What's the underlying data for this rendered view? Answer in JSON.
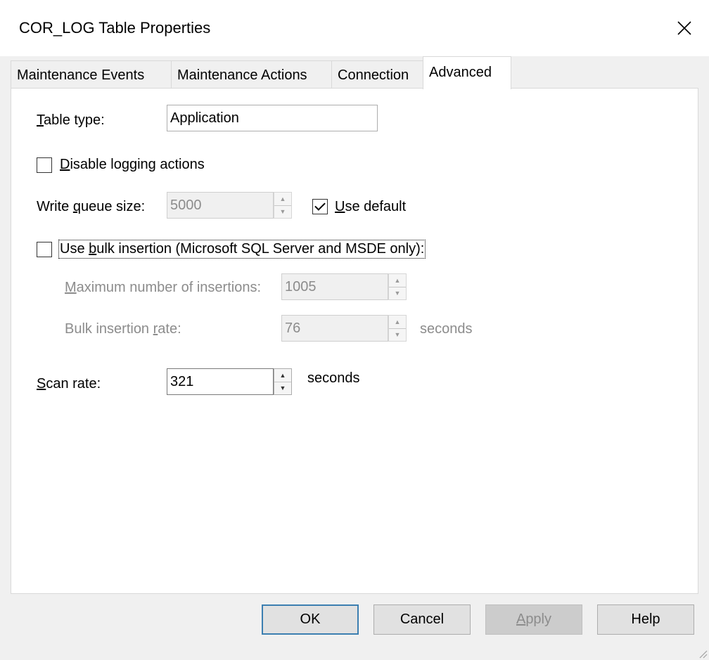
{
  "window": {
    "title": "COR_LOG Table Properties"
  },
  "tabs": [
    {
      "label": "Maintenance Events"
    },
    {
      "label": "Maintenance Actions"
    },
    {
      "label": "Connection"
    },
    {
      "label": "Advanced"
    }
  ],
  "advanced": {
    "table_type": {
      "label_first": "T",
      "label_rest": "able type:",
      "value": "Application"
    },
    "disable_logging": {
      "label_first": "D",
      "label_rest": "isable logging actions",
      "checked": false
    },
    "write_queue": {
      "label_pre": "Write ",
      "label_ul": "q",
      "label_post": "ueue size:",
      "value": "5000"
    },
    "use_default": {
      "label_first": "U",
      "label_rest": "se default",
      "checked": true
    },
    "bulk_insertion": {
      "label_pre": "Use ",
      "label_ul": "b",
      "label_post": "ulk insertion (Microsoft SQL Server and MSDE only):",
      "checked": false
    },
    "max_insertions": {
      "label_first": "M",
      "label_rest": "aximum number of insertions:",
      "value": "1005"
    },
    "bulk_rate": {
      "label_pre": "Bulk insertion ",
      "label_ul": "r",
      "label_post": "ate:",
      "value": "76",
      "unit": "seconds"
    },
    "scan_rate": {
      "label_first": "S",
      "label_rest": "can rate:",
      "value": "321",
      "unit": "seconds"
    }
  },
  "buttons": {
    "ok": "OK",
    "cancel": "Cancel",
    "apply_first": "A",
    "apply_rest": "pply",
    "help": "Help"
  },
  "icons": {
    "close": "close-icon",
    "spin_up": "spin-up-icon",
    "spin_down": "spin-down-icon",
    "resize": "resize-grip-icon"
  }
}
